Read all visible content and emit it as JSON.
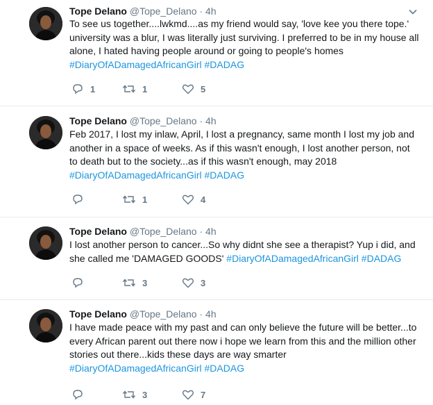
{
  "tweets": [
    {
      "name": "Tope Delano",
      "handle": "@Tope_Delano",
      "separator": "·",
      "time": "4h",
      "text": "To see us together....lwkmd....as my friend would say, 'love kee you there tope.' university was a blur, I was literally just surviving. I preferred to be in my house all alone, I hated having people around or going to people's homes",
      "hashtags": "#DiaryOfADamagedAfricanGirl #DADAG",
      "replies": "1",
      "retweets": "1",
      "likes": "5"
    },
    {
      "name": "Tope Delano",
      "handle": "@Tope_Delano",
      "separator": "·",
      "time": "4h",
      "text": "Feb 2017, I lost my inlaw, April, I lost a pregnancy, same month I lost my job and another in a space of weeks. As if this wasn't enough, I lost another person, not to death but to the society...as if this wasn't enough, may 2018",
      "hashtags": "#DiaryOfADamagedAfricanGirl #DADAG",
      "replies": "",
      "retweets": "1",
      "likes": "4"
    },
    {
      "name": "Tope Delano",
      "handle": "@Tope_Delano",
      "separator": "·",
      "time": "4h",
      "text": "I lost another person to cancer...So why didnt she see a therapist? Yup i did, and she called me 'DAMAGED GOODS' ",
      "hashtags": "#DiaryOfADamagedAfricanGirl #DADAG",
      "replies": "",
      "retweets": "3",
      "likes": "3"
    },
    {
      "name": "Tope Delano",
      "handle": "@Tope_Delano",
      "separator": "·",
      "time": "4h",
      "text": "I have made peace with my past and can only believe the future will be better...to every African parent out there now i hope we learn from this and the million other stories out there...kids these days are way smarter ",
      "hashtags": "#DiaryOfADamagedAfricanGirl #DADAG",
      "replies": "",
      "retweets": "3",
      "likes": "7"
    }
  ],
  "icons": {
    "reply": "reply-icon",
    "retweet": "retweet-icon",
    "like": "heart-icon",
    "more": "chevron-down-icon",
    "avatar": "avatar"
  },
  "colors": {
    "text": "#14171a",
    "secondary": "#657786",
    "hashtag": "#1b95e0",
    "divider": "#e6ecf0"
  }
}
